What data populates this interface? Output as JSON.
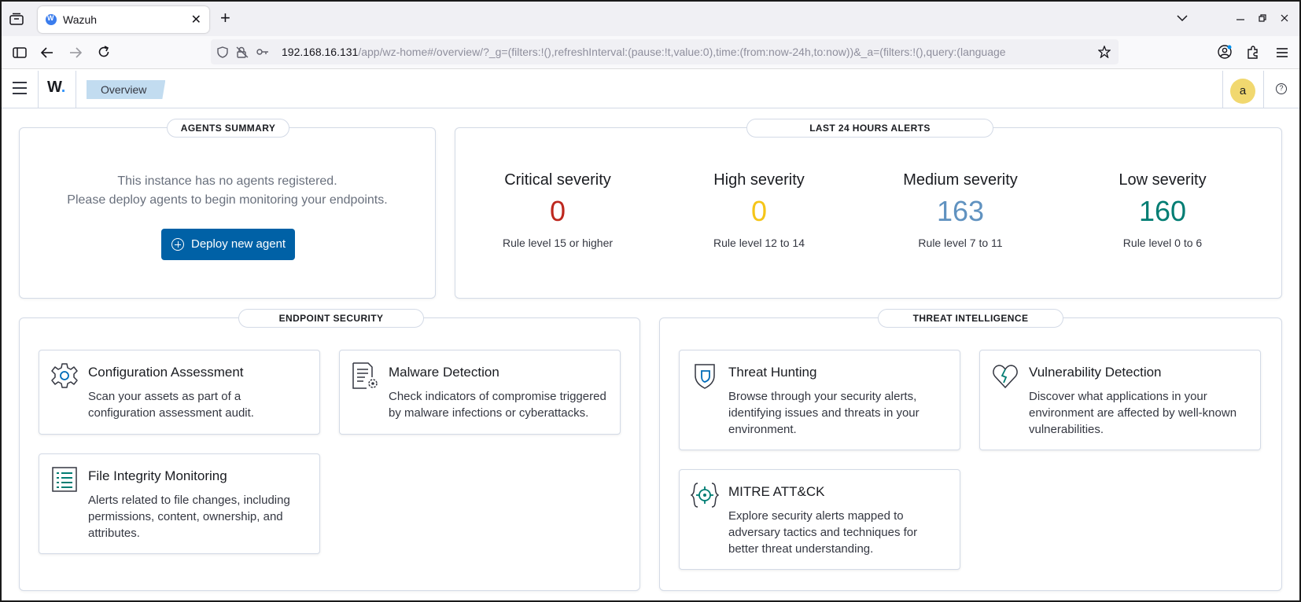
{
  "browser": {
    "tab_title": "Wazuh",
    "tab_close": "✕",
    "new_tab": "+",
    "url_host": "192.168.16.131",
    "url_path": "/app/wz-home#/overview/?_g=(filters:!(),refreshInterval:(pause:!t,value:0),time:(from:now-24h,to:now))&_a=(filters:!(),query:(language"
  },
  "app": {
    "logo": "W",
    "logo_dot": ".",
    "breadcrumb": "Overview",
    "avatar": "a",
    "help": "?"
  },
  "agents_summary": {
    "title": "AGENTS SUMMARY",
    "line1": "This instance has no agents registered.",
    "line2": "Please deploy agents to begin monitoring your endpoints.",
    "deploy_label": "Deploy new agent"
  },
  "alerts": {
    "title": "LAST 24 HOURS ALERTS",
    "items": [
      {
        "title": "Critical severity",
        "count": "0",
        "desc": "Rule level 15 or higher",
        "color": "#bd271e"
      },
      {
        "title": "High severity",
        "count": "0",
        "desc": "Rule level 12 to 14",
        "color": "#f5c518"
      },
      {
        "title": "Medium severity",
        "count": "163",
        "desc": "Rule level 7 to 11",
        "color": "#6092c0"
      },
      {
        "title": "Low severity",
        "count": "160",
        "desc": "Rule level 0 to 6",
        "color": "#017d73"
      }
    ]
  },
  "endpoint_security": {
    "title": "ENDPOINT SECURITY",
    "cards": [
      {
        "title": "Configuration Assessment",
        "desc": "Scan your assets as part of a configuration assessment audit."
      },
      {
        "title": "Malware Detection",
        "desc": "Check indicators of compromise triggered by malware infections or cyberattacks."
      },
      {
        "title": "File Integrity Monitoring",
        "desc": "Alerts related to file changes, including permissions, content, ownership, and attributes."
      }
    ]
  },
  "threat_intelligence": {
    "title": "THREAT INTELLIGENCE",
    "cards": [
      {
        "title": "Threat Hunting",
        "desc": "Browse through your security alerts, identifying issues and threats in your environment."
      },
      {
        "title": "Vulnerability Detection",
        "desc": "Discover what applications in your environment are affected by well-known vulnerabilities."
      },
      {
        "title": "MITRE ATT&CK",
        "desc": "Explore security alerts mapped to adversary tactics and techniques for better threat understanding."
      }
    ]
  }
}
